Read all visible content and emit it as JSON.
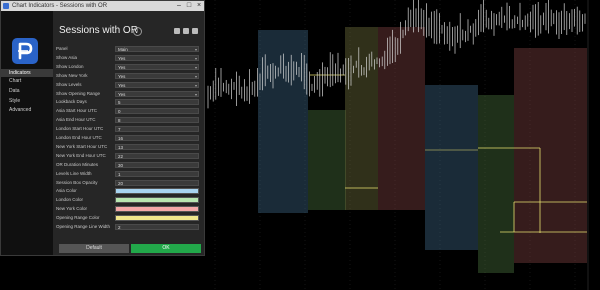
{
  "window": {
    "title": "Chart Indicators - Sessions with OR",
    "min_icon": "minimize-icon",
    "max_icon": "maximize-icon",
    "close_icon": "close-icon"
  },
  "sidebar": {
    "items": [
      {
        "label": "Indicators",
        "active": true
      },
      {
        "label": "Chart",
        "active": false
      },
      {
        "label": "Data",
        "active": false
      },
      {
        "label": "Style",
        "active": false
      },
      {
        "label": "Advanced",
        "active": false
      }
    ]
  },
  "dialog": {
    "title": "Sessions with OR",
    "help_icon": "info-icon"
  },
  "params": [
    {
      "label": "Panel",
      "value": "Main",
      "type": "select"
    },
    {
      "label": "Show Asia",
      "value": "Yes",
      "type": "select"
    },
    {
      "label": "Show London",
      "value": "Yes",
      "type": "select"
    },
    {
      "label": "Show New York",
      "value": "Yes",
      "type": "select"
    },
    {
      "label": "Show Levels",
      "value": "Yes",
      "type": "select"
    },
    {
      "label": "Show Opening Range",
      "value": "Yes",
      "type": "select"
    },
    {
      "label": "Lookback Days",
      "value": "5",
      "type": "input"
    },
    {
      "label": "Asia Start Hour UTC",
      "value": "0",
      "type": "input"
    },
    {
      "label": "Asia End Hour UTC",
      "value": "8",
      "type": "input"
    },
    {
      "label": "London Start Hour UTC",
      "value": "7",
      "type": "input"
    },
    {
      "label": "London End Hour UTC",
      "value": "16",
      "type": "input"
    },
    {
      "label": "New York Start Hour UTC",
      "value": "13",
      "type": "input"
    },
    {
      "label": "New York End Hour UTC",
      "value": "22",
      "type": "input"
    },
    {
      "label": "OR Duration Minutes",
      "value": "30",
      "type": "input"
    },
    {
      "label": "Levels Line Width",
      "value": "1",
      "type": "input"
    },
    {
      "label": "Session Box Opacity",
      "value": "20",
      "type": "input"
    },
    {
      "label": "Asia Color",
      "color": "#a8d4f0",
      "type": "color"
    },
    {
      "label": "London Color",
      "color": "#b8e6b0",
      "type": "color"
    },
    {
      "label": "New York Color",
      "color": "#f4a8a8",
      "type": "color"
    },
    {
      "label": "Opening Range Color",
      "color": "#f0e68c",
      "type": "color"
    },
    {
      "label": "Opening Range Line Width",
      "value": "2",
      "type": "input"
    }
  ],
  "buttons": {
    "default_label": "Default",
    "ok_label": "OK"
  },
  "chart_data": {
    "type": "candlestick",
    "boxes": [
      {
        "session": "Asia",
        "color": "#4a7aa0"
      },
      {
        "session": "London",
        "color": "#5a8a4a"
      },
      {
        "session": "London",
        "color": "#6a6a3a"
      },
      {
        "session": "New York",
        "color": "#9a5050"
      },
      {
        "session": "Asia",
        "color": "#4a7aa0"
      },
      {
        "session": "London",
        "color": "#5a8a4a"
      },
      {
        "session": "New York",
        "color": "#9a5050"
      }
    ]
  }
}
